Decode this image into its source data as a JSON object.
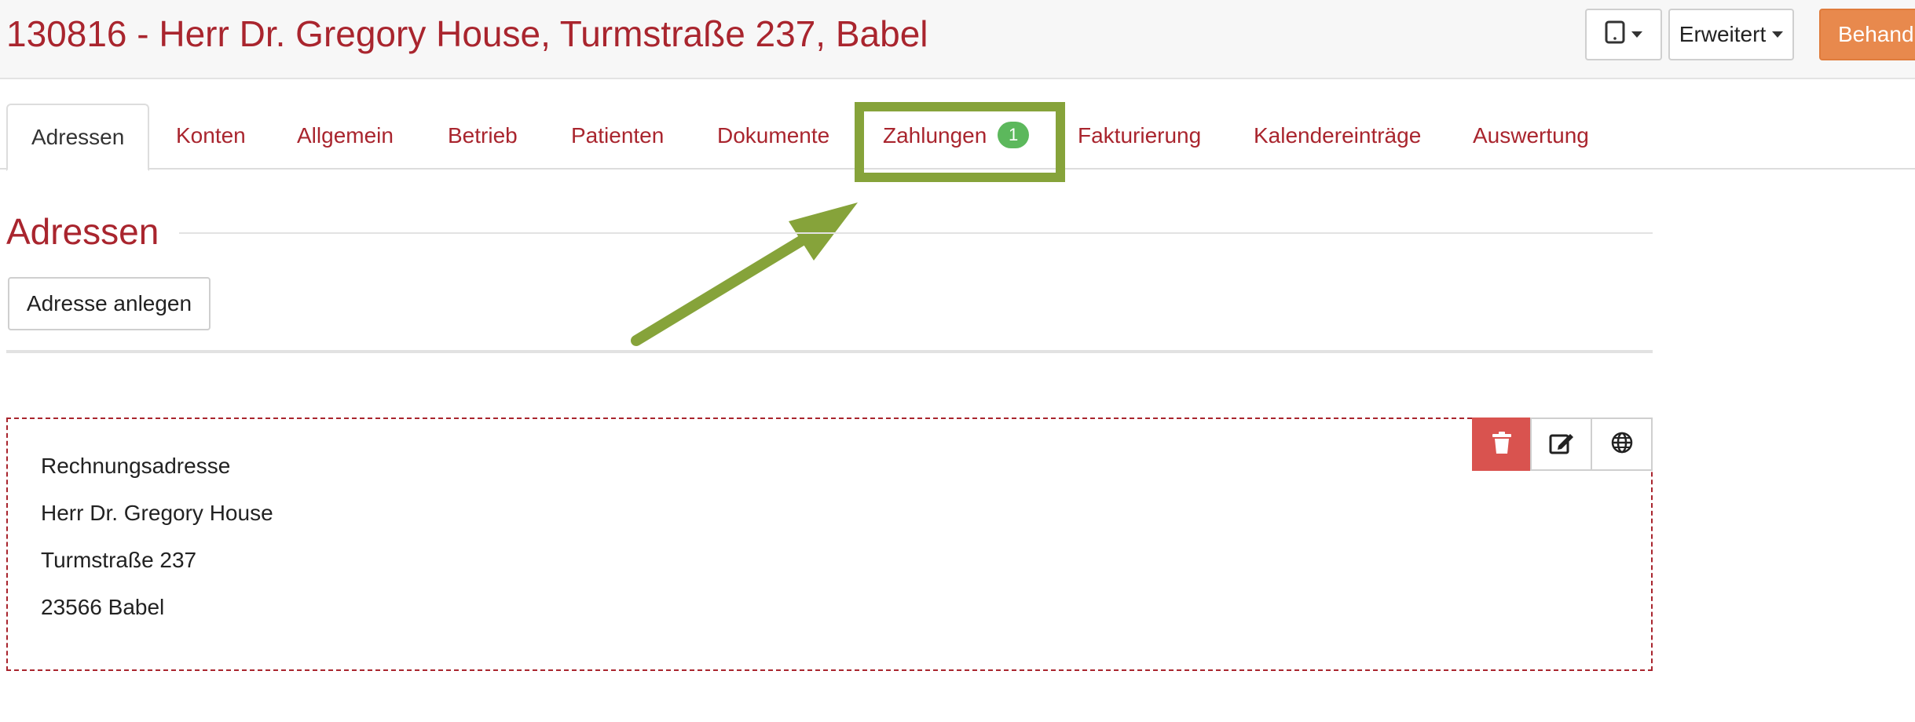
{
  "header": {
    "title": "130816 - Herr Dr. Gregory House, Turmstraße 237, Babel",
    "device_icon": "tablet-icon",
    "advanced_label": "Erweitert",
    "treat_label": "Behand"
  },
  "tabs": [
    {
      "label": "Adressen",
      "active": true
    },
    {
      "label": "Konten"
    },
    {
      "label": "Allgemein"
    },
    {
      "label": "Betrieb"
    },
    {
      "label": "Patienten"
    },
    {
      "label": "Dokumente"
    },
    {
      "label": "Zahlungen",
      "badge": "1"
    },
    {
      "label": "Fakturierung"
    },
    {
      "label": "Kalendereinträge"
    },
    {
      "label": "Auswertung"
    }
  ],
  "section": {
    "title": "Adressen",
    "create_label": "Adresse anlegen"
  },
  "address_card": {
    "lines": [
      "Rechnungsadresse",
      "Herr Dr. Gregory House",
      "Turmstraße 237",
      "23566 Babel"
    ],
    "actions": [
      "trash-icon",
      "edit-icon",
      "globe-icon"
    ]
  },
  "colors": {
    "brand_red": "#a9252e",
    "annotation_green": "#86a33a",
    "badge_green": "#5cb85c",
    "delete_red": "#d9534f",
    "orange": "#e8894d"
  }
}
